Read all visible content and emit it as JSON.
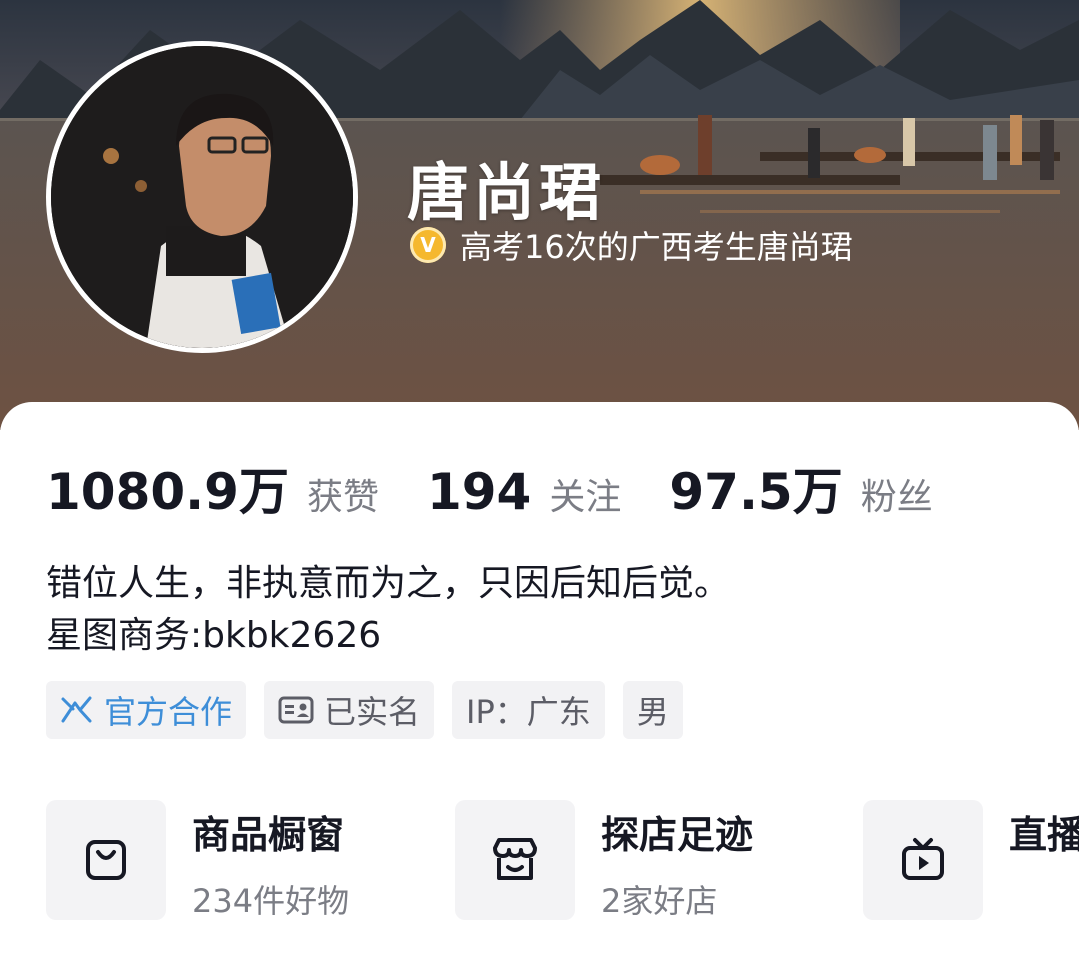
{
  "profile": {
    "name": "唐尚珺",
    "verification": "高考16次的广西考生唐尚珺",
    "verify_badge_letter": "V"
  },
  "stats": [
    {
      "value": "1080.9万",
      "label": "获赞"
    },
    {
      "value": "194",
      "label": "关注"
    },
    {
      "value": "97.5万",
      "label": "粉丝"
    }
  ],
  "bio": {
    "line1": "错位人生，非执意而为之，只因后知后觉。",
    "line2": "星图商务:bkbk2626"
  },
  "tags": [
    {
      "label": "官方合作",
      "icon": "official-cooperation-icon"
    },
    {
      "label": "已实名",
      "icon": "id-card-icon"
    },
    {
      "label": "IP：广东"
    },
    {
      "label": "男"
    }
  ],
  "features": [
    {
      "title": "商品橱窗",
      "subtitle": "234件好物",
      "icon": "shopping-bag-icon"
    },
    {
      "title": "探店足迹",
      "subtitle": "2家好店",
      "icon": "store-icon"
    },
    {
      "title": "直播",
      "icon": "tv-icon"
    }
  ],
  "colors": {
    "accent_blue": "#3e8ed8",
    "badge_gold": "#f5b82e",
    "text_primary": "#161823",
    "text_secondary": "#7b7d85"
  }
}
